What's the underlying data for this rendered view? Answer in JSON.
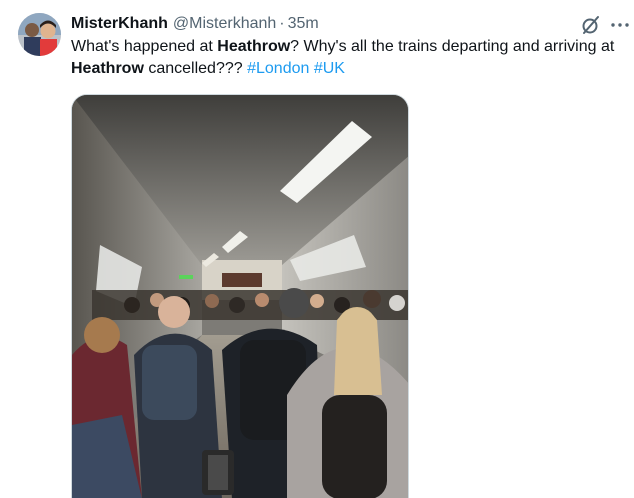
{
  "tweet": {
    "display_name": "MisterKhanh",
    "handle": "@Misterkhanh",
    "separator": "·",
    "timestamp": "35m",
    "text_segments": [
      {
        "text": "What's happened at ",
        "style": "plain"
      },
      {
        "text": "Heathrow",
        "style": "bold"
      },
      {
        "text": "? Why's all the trains departing and arriving at ",
        "style": "plain"
      },
      {
        "text": "Heathrow",
        "style": "bold"
      },
      {
        "text": " cancelled??? ",
        "style": "plain"
      },
      {
        "text": "#London",
        "style": "hashtag"
      },
      {
        "text": " ",
        "style": "plain"
      },
      {
        "text": "#UK",
        "style": "hashtag"
      }
    ],
    "media": {
      "kind": "photo",
      "subject": "crowded underground station tunnel with passengers"
    }
  },
  "icons": {
    "avatar": "user-avatar",
    "grok": "grok-icon",
    "more": "more-icon"
  },
  "colors": {
    "text_primary": "#0f1419",
    "text_secondary": "#536471",
    "hashtag": "#1d9bf0"
  }
}
